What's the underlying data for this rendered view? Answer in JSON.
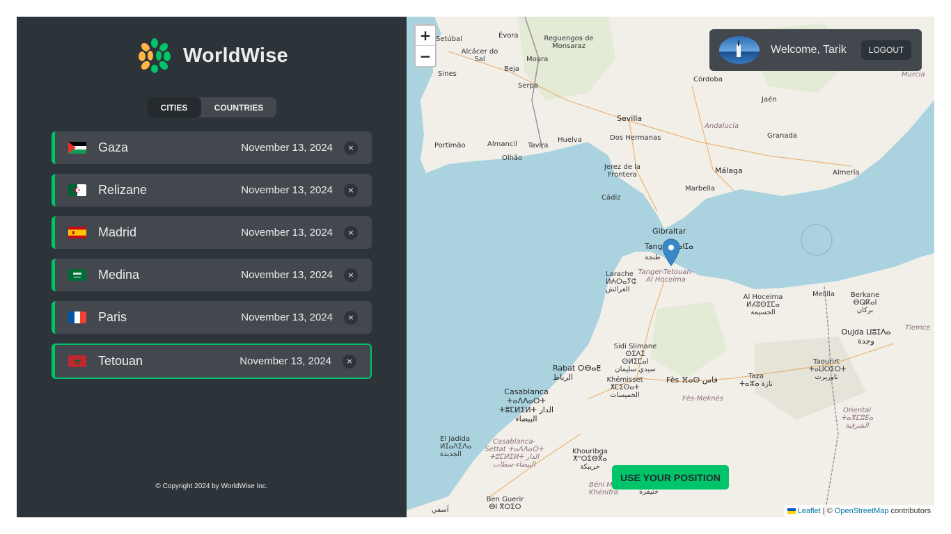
{
  "app": {
    "name": "WorldWise"
  },
  "tabs": [
    {
      "label": "CITIES",
      "active": true
    },
    {
      "label": "COUNTRIES",
      "active": false
    }
  ],
  "cities": [
    {
      "name": "Gaza",
      "date": "November 13, 2024",
      "flag": "palestine-flag",
      "active": false
    },
    {
      "name": "Relizane",
      "date": "November 13, 2024",
      "flag": "algeria-flag",
      "active": false
    },
    {
      "name": "Madrid",
      "date": "November 13, 2024",
      "flag": "spain-flag",
      "active": false
    },
    {
      "name": "Medina",
      "date": "November 13, 2024",
      "flag": "saudi-flag",
      "active": false
    },
    {
      "name": "Paris",
      "date": "November 13, 2024",
      "flag": "france-flag",
      "active": false
    },
    {
      "name": "Tetouan",
      "date": "November 13, 2024",
      "flag": "morocco-flag",
      "active": true
    }
  ],
  "delete_label": "×",
  "copyright": "© Copyright 2024 by WorldWise Inc.",
  "map": {
    "zoom_in": "+",
    "zoom_out": "−",
    "user_greeting": "Welcome, Tarik",
    "logout_label": "LOGOUT",
    "position_button": "USE YOUR POSITION",
    "attribution": {
      "leaflet": "Leaflet",
      "separator": " | © ",
      "osm": "OpenStreetMap",
      "suffix": " contributors"
    },
    "labels": {
      "setubal": "Setúbal",
      "alcacer": "Alcácer do Sal",
      "evora": "Évora",
      "reguengos": "Reguengos de Monsaraz",
      "moura": "Moura",
      "beja": "Beja",
      "serpa": "Serpa",
      "sines": "Sines",
      "cordoba": "Córdoba",
      "jaen": "Jaén",
      "murcia": "Murcia",
      "sevilla": "Sevilla",
      "dos_hermanas": "Dos Hermanas",
      "andalucia": "Andalucía",
      "granada": "Granada",
      "portimao": "Portimão",
      "almancil": "Almancil",
      "tavira": "Tavira",
      "huelva": "Huelva",
      "olhao": "Olhão",
      "jerez": "Jerez de la Frontera",
      "malaga": "Málaga",
      "almeria": "Almería",
      "marbella": "Marbella",
      "cadiz": "Cádiz",
      "gibraltar": "Gibraltar",
      "tanger": "Tanger ⵟⴰⵏⵊⴰ",
      "tanger_ar": "طنجة",
      "larache": "Larache ⵍⵄⵔⴰⵢⵛ العرائش",
      "tetouan_region": "Tanger-Tetouan-Al Hoceima",
      "al_hoceima": "Al Hoceima ⵍⵃⵓⵙⵉⵎⴰ الحسيمة",
      "melilla": "Melilla",
      "berkane": "Berkane ⴱⵕⴽⴰⵏ بركان",
      "oujda": "Oujda ⵡⵓⵊⴷⴰ وجدة",
      "tlemcen": "Tlemce",
      "sidi_slimane": "Sidi Slimane ⵙⵉⴷⵉ ⵙⵍⵉⵎⴰⵏ سيدي سليمان",
      "rabat": "Rabat ⵔⴱⴰⵟ الرباط",
      "khemisset": "Khémisset ⵅⵎⵉⵙⴰⵜ الخميسات",
      "fes": "Fès ⴼⴰⵙ فاس",
      "taza": "Taza ⵜⴰⵣⴰ تازة",
      "taourirt": "Taourirt ⵜⴰⵡⵔⵉⵔⵜ تاوريرت",
      "fes_meknes": "Fès-Meknès",
      "oriental": "Oriental ⵜⴰⴳⵎⵓⴹⴰ الشرقية",
      "casablanca": "Casablanca ⵜⴰⴷⴷⴰⵔⵜ ⵜⵓⵎⵍⵉⵍⵜ الدار البيضاء",
      "el_jadida": "El Jadida ⵍⵊⴰⴷⵉⴷⴰ الجديدة",
      "casa_settat": "Casablanca-Settat ⵜⴰⴷⴷⴰⵔⵜ ⵜⵓⵎⵍⵉⵍⵜ الدار البيضاء-سطات",
      "khouribga": "Khouribga ⵅⵯⵔⵉⴱⴳⴰ خريبكة",
      "beni_mellal": "Béni Mellal-Khénifra",
      "ben_guerir": "Ben Guerir ⴱⵏ ⴳⵔⵉⵔ",
      "khenifra": "خنيفرة",
      "safi": "آسفي"
    }
  },
  "colors": {
    "accent": "#00c46a",
    "sidebar_bg": "#2d3439",
    "item_bg": "#42484d",
    "sea": "#aad3df",
    "land": "#f2efe9"
  }
}
